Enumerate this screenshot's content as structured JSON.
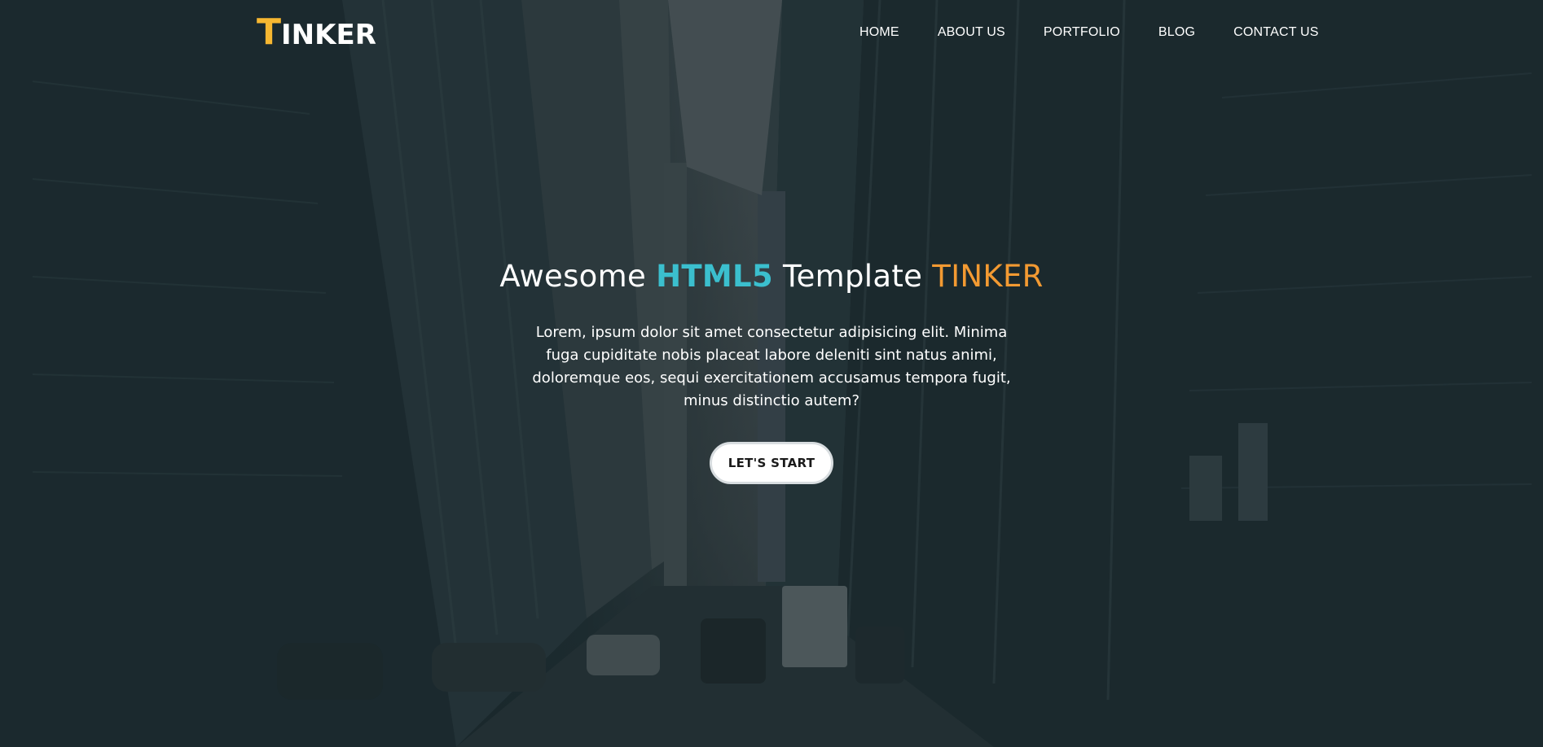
{
  "brand": {
    "logo_first_letter": "T",
    "logo_rest": "INKER",
    "accent_color": "#f7b731"
  },
  "nav": {
    "items": [
      {
        "label": "HOME"
      },
      {
        "label": "ABOUT US"
      },
      {
        "label": "PORTFOLIO"
      },
      {
        "label": "BLOG"
      },
      {
        "label": "CONTACT US"
      }
    ]
  },
  "hero": {
    "title_part1": "Awesome ",
    "title_accent1": "HTML5",
    "title_part2": " Template ",
    "title_accent2": "TINKER",
    "accent1_color": "#3bbfce",
    "accent2_color": "#f39a32",
    "description": "Lorem, ipsum dolor sit amet consectetur adipisicing elit. Minima fuga cupiditate nobis placeat labore deleniti sint natus animi, doloremque eos, sequi exercitationem accusamus tempora fugit, minus distinctio autem?",
    "cta_label": "LET'S START"
  }
}
